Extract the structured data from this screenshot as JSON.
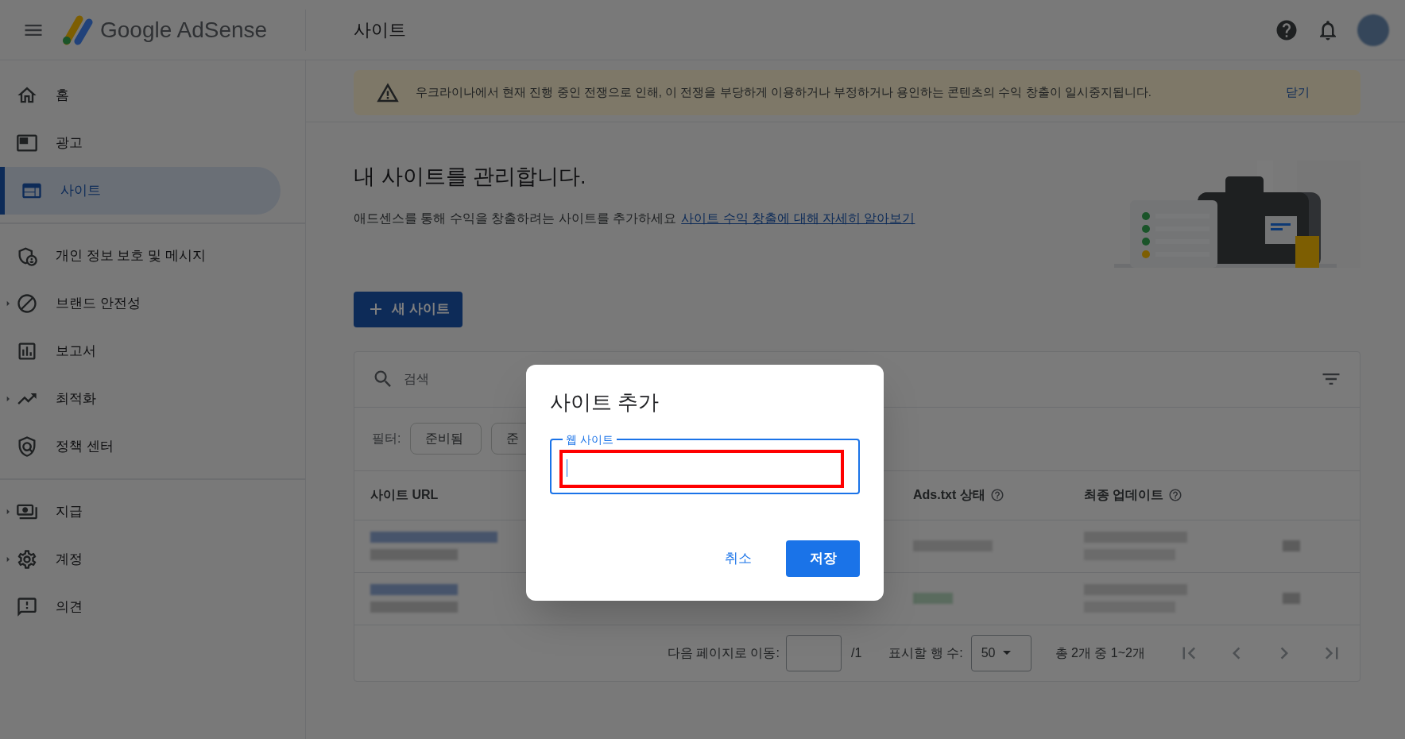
{
  "header": {
    "product": "Google AdSense",
    "page_title": "사이트"
  },
  "sidebar": {
    "groups": [
      {
        "items": [
          {
            "label": "홈",
            "selected": false,
            "expandable": false
          },
          {
            "label": "광고",
            "selected": false,
            "expandable": false
          },
          {
            "label": "사이트",
            "selected": true,
            "expandable": false
          }
        ]
      },
      {
        "items": [
          {
            "label": "개인 정보 보호 및 메시지",
            "selected": false,
            "expandable": false
          },
          {
            "label": "브랜드 안전성",
            "selected": false,
            "expandable": true
          },
          {
            "label": "보고서",
            "selected": false,
            "expandable": false
          },
          {
            "label": "최적화",
            "selected": false,
            "expandable": true
          },
          {
            "label": "정책 센터",
            "selected": false,
            "expandable": false
          }
        ]
      },
      {
        "items": [
          {
            "label": "지급",
            "selected": false,
            "expandable": true
          },
          {
            "label": "계정",
            "selected": false,
            "expandable": true
          },
          {
            "label": "의견",
            "selected": false,
            "expandable": false
          }
        ]
      }
    ]
  },
  "banner": {
    "message": "우크라이나에서 현재 진행 중인 전쟁으로 인해, 이 전쟁을 부당하게 이용하거나 부정하거나 용인하는 콘텐츠의 수익 창출이 일시중지됩니다.",
    "action": "닫기"
  },
  "intro": {
    "heading": "내 사이트를 관리합니다.",
    "text": "애드센스를 통해 수익을 창출하려는 사이트를 추가하세요",
    "link": "사이트 수익 창출에 대해 자세히 알아보기"
  },
  "new_site_button": "새 사이트",
  "table": {
    "search": {
      "placeholder": "검색"
    },
    "filter_label": "필터:",
    "filters": [
      "준비됨",
      "준"
    ],
    "columns": [
      {
        "label": "사이트 URL"
      },
      {
        "label": "Ads.txt 상태",
        "help": true
      },
      {
        "label": "최종 업데이트",
        "help": true
      }
    ],
    "footer": {
      "goto_label": "다음 페이지로 이동:",
      "page_total": "/1",
      "rows_label": "표시할 행 수:",
      "rows_value": "50",
      "range": "총 2개 중 1~2개"
    }
  },
  "dialog": {
    "title": "사이트 추가",
    "field": {
      "label": "웹 사이트",
      "focused": true
    },
    "highlight": true,
    "buttons": [
      {
        "label": "취소",
        "kind": "text"
      },
      {
        "label": "저장",
        "kind": "filled"
      }
    ]
  }
}
